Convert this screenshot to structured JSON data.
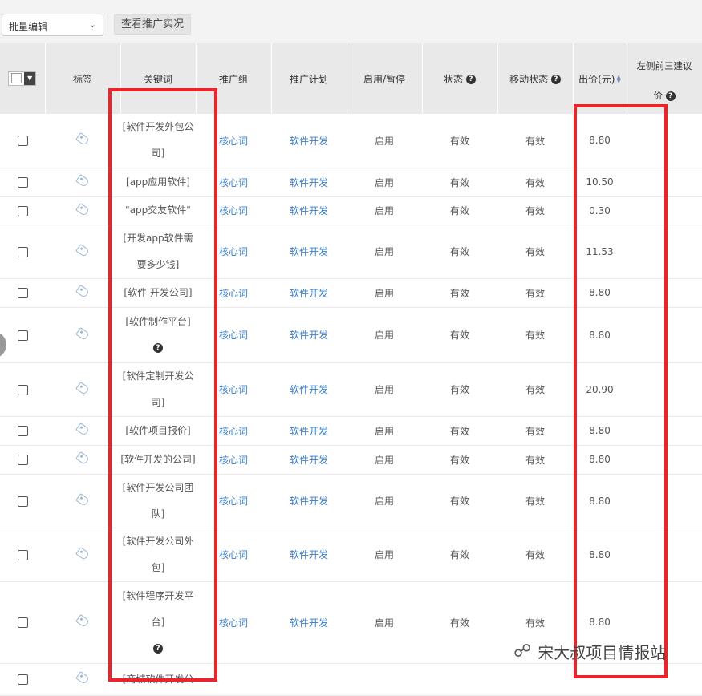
{
  "toolbar": {
    "batch_edit": "批量编辑",
    "view_live": "查看推广实况"
  },
  "table": {
    "headers": [
      "标签",
      "关键词",
      "推广组",
      "推广计划",
      "启用/暂停",
      "状态",
      "移动状态",
      "出价(元)",
      "左侧前三建议价"
    ],
    "header_suggest_line1": "左侧前三建议",
    "header_suggest_line2": "价",
    "rows": [
      {
        "kw1": "[软件开发外包公",
        "kw2": "司]",
        "group": "核心词",
        "plan": "软件开发",
        "enable": "启用",
        "status": "有效",
        "mstatus": "有效",
        "bid": "8.80"
      },
      {
        "kw1": "[app应用软件]",
        "group": "核心词",
        "plan": "软件开发",
        "enable": "启用",
        "status": "有效",
        "mstatus": "有效",
        "bid": "10.50"
      },
      {
        "kw1": "\"app交友软件\"",
        "group": "核心词",
        "plan": "软件开发",
        "enable": "启用",
        "status": "有效",
        "mstatus": "有效",
        "bid": "0.30"
      },
      {
        "kw1": "[开发app软件需",
        "kw2": "要多少钱]",
        "group": "核心词",
        "plan": "软件开发",
        "enable": "启用",
        "status": "有效",
        "mstatus": "有效",
        "bid": "11.53"
      },
      {
        "kw1": "[软件 开发公司]",
        "group": "核心词",
        "plan": "软件开发",
        "enable": "启用",
        "status": "有效",
        "mstatus": "有效",
        "bid": "8.80"
      },
      {
        "kw1": "[软件制作平台]",
        "q": true,
        "group": "核心词",
        "plan": "软件开发",
        "enable": "启用",
        "status": "有效",
        "mstatus": "有效",
        "bid": "8.80"
      },
      {
        "kw1": "[软件定制开发公",
        "kw2": "司]",
        "group": "核心词",
        "plan": "软件开发",
        "enable": "启用",
        "status": "有效",
        "mstatus": "有效",
        "bid": "20.90"
      },
      {
        "kw1": "[软件项目报价]",
        "group": "核心词",
        "plan": "软件开发",
        "enable": "启用",
        "status": "有效",
        "mstatus": "有效",
        "bid": "8.80"
      },
      {
        "kw1": "[软件开发的公司]",
        "group": "核心词",
        "plan": "软件开发",
        "enable": "启用",
        "status": "有效",
        "mstatus": "有效",
        "bid": "8.80"
      },
      {
        "kw1": "[软件开发公司团",
        "kw2": "队]",
        "group": "核心词",
        "plan": "软件开发",
        "enable": "启用",
        "status": "有效",
        "mstatus": "有效",
        "bid": "8.80"
      },
      {
        "kw1": "[软件开发公司外",
        "kw2": "包]",
        "group": "核心词",
        "plan": "软件开发",
        "enable": "启用",
        "status": "有效",
        "mstatus": "有效",
        "bid": "8.80"
      },
      {
        "kw1": "[软件程序开发平",
        "kw2": "台]",
        "q": true,
        "group": "核心词",
        "plan": "软件开发",
        "enable": "启用",
        "status": "有效",
        "mstatus": "有效",
        "bid": "8.80"
      },
      {
        "kw1": "[商城软件开发公",
        "group": "",
        "plan": "",
        "enable": "",
        "status": "",
        "mstatus": "",
        "bid": ""
      }
    ]
  },
  "watermark": {
    "text": "宋大叔项目情报站",
    "icon": "wechat-icon"
  },
  "colors": {
    "highlight_box": "#e8252a",
    "link": "#3a7ec8"
  }
}
